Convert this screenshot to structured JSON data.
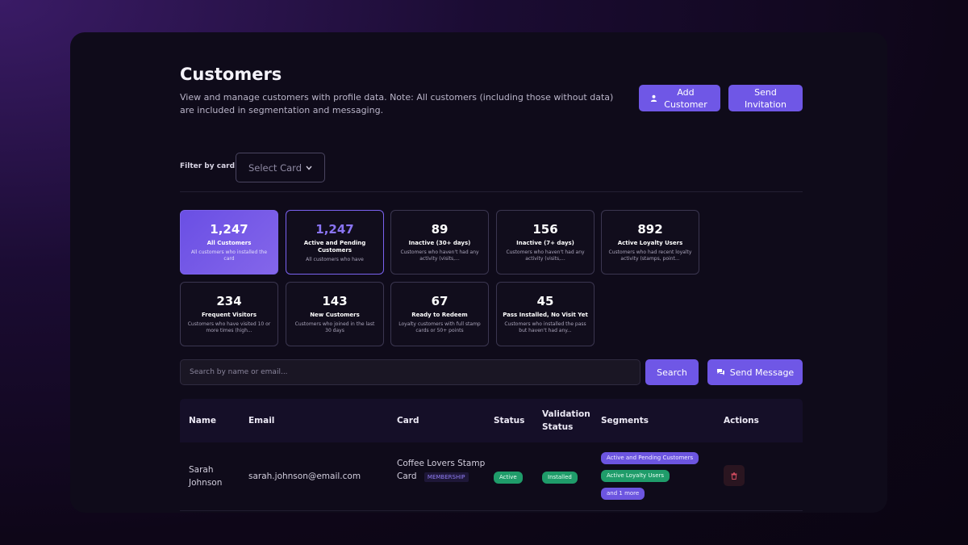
{
  "header": {
    "title": "Customers",
    "description": "View and manage customers with profile data. Note: All customers (including those without data) are included in segmentation and messaging.",
    "add_customer_label": "Add Customer",
    "send_invitation_label": "Send Invitation"
  },
  "filter": {
    "label": "Filter by card:",
    "select_label": "Select Card"
  },
  "stats": [
    {
      "value": "1,247",
      "title": "All Customers",
      "desc": "All customers who installed the card"
    },
    {
      "value": "1,247",
      "title": "Active and Pending Customers",
      "desc": "All customers who have"
    },
    {
      "value": "89",
      "title": "Inactive (30+ days)",
      "desc": "Customers who haven't had any activity (visits,..."
    },
    {
      "value": "156",
      "title": "Inactive (7+ days)",
      "desc": "Customers who haven't had any activity (visits,..."
    },
    {
      "value": "892",
      "title": "Active Loyalty Users",
      "desc": "Customers who had recent loyalty activity (stamps, point..."
    },
    {
      "value": "234",
      "title": "Frequent Visitors",
      "desc": "Customers who have visited 10 or more times (high..."
    },
    {
      "value": "143",
      "title": "New Customers",
      "desc": "Customers who joined in the last 30 days"
    },
    {
      "value": "67",
      "title": "Ready to Redeem",
      "desc": "Loyalty customers with full stamp cards or 50+ points"
    },
    {
      "value": "45",
      "title": "Pass Installed, No Visit Yet",
      "desc": "Customers who installed the pass but haven't had any..."
    }
  ],
  "search": {
    "placeholder": "Search by name or email...",
    "search_label": "Search",
    "send_message_label": "Send Message"
  },
  "table": {
    "headers": [
      "Name",
      "Email",
      "Card",
      "Status",
      "Validation Status",
      "Segments",
      "Actions"
    ],
    "rows": [
      {
        "name": "Sarah Johnson",
        "email": "sarah.johnson@email.com",
        "card": "Coffee Lovers Stamp Card",
        "card_type": "MEMBERSHIP",
        "status": "Active",
        "validation": "Installed",
        "segments": [
          "Active and Pending Customers",
          "Active Loyalty Users",
          "and 1 more"
        ]
      }
    ]
  },
  "colors": {
    "accent": "#6f57e6",
    "success": "#1f9c6a",
    "danger": "#d24c5f",
    "panel": "#0f0b1a"
  }
}
